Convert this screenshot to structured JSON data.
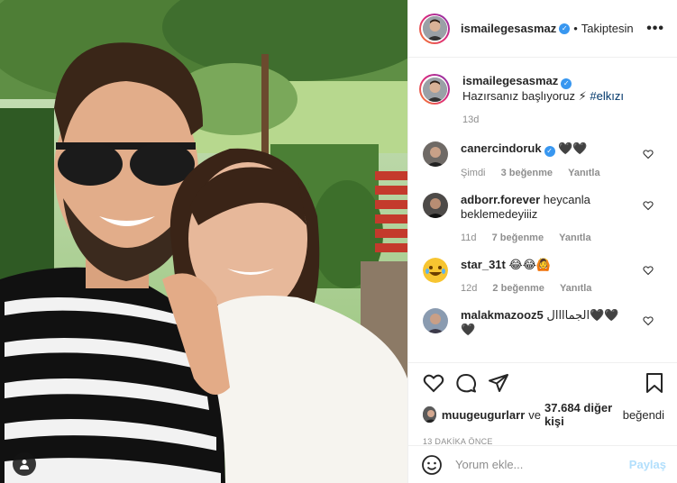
{
  "post": {
    "author": "ismailegesasmaz",
    "follow_sep": "•",
    "follow_status": "Takiptesin",
    "more": "•••",
    "caption_text": "Hazırsanız başlıyoruz ⚡",
    "caption_hashtag": "#elkızı",
    "caption_time": "13d"
  },
  "comments": [
    {
      "user": "canercindoruk",
      "verified": true,
      "text": "🖤🖤",
      "time": "Şimdi",
      "likes": "3 beğenme",
      "reply": "Yanıtla"
    },
    {
      "user": "adborr.forever",
      "verified": false,
      "text": "heycanla beklemedeyiiiz",
      "time": "11d",
      "likes": "7 beğenme",
      "reply": "Yanıtla"
    },
    {
      "user": "star_31t",
      "verified": false,
      "text": "😂😂🙆",
      "time": "12d",
      "likes": "2 beğenme",
      "reply": "Yanıtla"
    },
    {
      "user": "malakmazooz5",
      "verified": false,
      "text": "الجماااال🖤🖤🖤",
      "time": "",
      "likes": "",
      "reply": ""
    }
  ],
  "likes": {
    "first_user": "muugeugurlarr",
    "connector": "ve",
    "others": "37.684 diğer kişi",
    "suffix": "beğendi"
  },
  "posted_ago": "13 DAKİKA ÖNCE",
  "comment_input": {
    "placeholder": "Yorum ekle...",
    "submit_label": "Paylaş"
  },
  "colors": {
    "accent": "#3897f0",
    "muted": "#8e8e8e",
    "border": "#efefef",
    "share_disabled": "#b2dffc"
  },
  "icons": [
    "tag-user-icon",
    "verified-icon",
    "more-options-icon",
    "heart-icon",
    "comment-icon",
    "share-icon",
    "bookmark-icon",
    "emoji-icon"
  ]
}
